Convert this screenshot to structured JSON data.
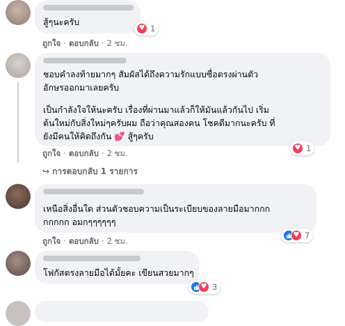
{
  "comments": [
    {
      "text_lines": [
        "สู้ๆนะครับ"
      ],
      "reaction_count": "1",
      "meta": {
        "like": "ถูกใจ",
        "reply": "ตอบกลับ",
        "time": "2 ชม."
      }
    },
    {
      "text_lines": [
        "ชอบคำลงท้ายมากๆ สัมผัสได้ถึงความรักแบบซื่อตรงผ่านตัว",
        "อักษรออกมาเลยครับ",
        "เป็นกำลังใจให้นะครับ เรื่องที่ผ่านมาแล้วก็ให้มันแล้วกันไป เริ่ม",
        "ต้นใหม่กับสิ่งใหม่ๆครับผม ถือว่าคุณสองคน โชคดีมากนะครับ ที่",
        "ยังมีคนให้คิดถึงกัน"
      ],
      "tail_emoji": "💕",
      "tail_text": "สู้ๆครับ",
      "reaction_count": "1",
      "meta": {
        "like": "ถูกใจ",
        "reply": "ตอบกลับ",
        "time": "2 ชม."
      },
      "replies_link": "↪  การตอบกลับ 1 รายการ"
    },
    {
      "text_lines": [
        "เหนือสิ่งอื่นใด ส่วนตัวชอบความเป็นระเบียบของลายมือมากกก",
        "กกกกก อมกๆๆๆๆๆๆ"
      ],
      "reaction_count": "7",
      "meta": {
        "like": "ถูกใจ",
        "reply": "ตอบกลับ",
        "time": "2 ชม."
      }
    },
    {
      "text_lines": [
        "โฟกัสตรงลายมือได้มั้ยคะ เขียนสวยมากๆ"
      ],
      "reaction_count": "3"
    }
  ],
  "icons": {
    "heart": "♥",
    "like": "👍"
  },
  "colors": {
    "bubble": "#f0f2f5",
    "meta": "#65676b",
    "heart": "#f33e58",
    "like": "#1877f2"
  }
}
